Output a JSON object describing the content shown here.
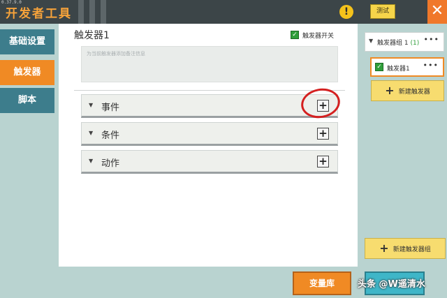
{
  "app": {
    "version": "0.37.9.0",
    "title": "开发者工具",
    "warning_icon": "!",
    "test_button_label": "测试",
    "close_icon": "✕"
  },
  "left_nav": {
    "tabs": [
      {
        "label": "基础设置",
        "active": false
      },
      {
        "label": "触发器",
        "active": true
      },
      {
        "label": "脚本",
        "active": false
      }
    ]
  },
  "main": {
    "trigger_title": "触发器1",
    "trigger_switch_label": "触发器开关",
    "trigger_switch_checked": true,
    "remark_placeholder": "为当前触发器添加备注信息",
    "sections": [
      {
        "label": "事件",
        "arrow": "▼",
        "add_icon": "+"
      },
      {
        "label": "条件",
        "arrow": "▼",
        "add_icon": "+"
      },
      {
        "label": "动作",
        "arrow": "▼",
        "add_icon": "+"
      }
    ]
  },
  "right_panel": {
    "group_name": "触发器组 1 ",
    "group_count": "(1)",
    "group_more": "•••",
    "trigger_item_label": "触发器1",
    "trigger_item_checked": true,
    "trigger_item_more": "•••",
    "new_trigger_label": "新建触发器",
    "new_group_label": "新建触发器组",
    "plus_icon": "+"
  },
  "bottom": {
    "variables_button_label": "变量库",
    "watermark": "头条 @W遥清水"
  },
  "colors": {
    "accent_orange": "#f08a24",
    "nav_teal": "#3d7d8c",
    "check_green": "#2f9e3a",
    "button_yellow": "#f7dc6f",
    "annotation_red": "#d42020"
  }
}
